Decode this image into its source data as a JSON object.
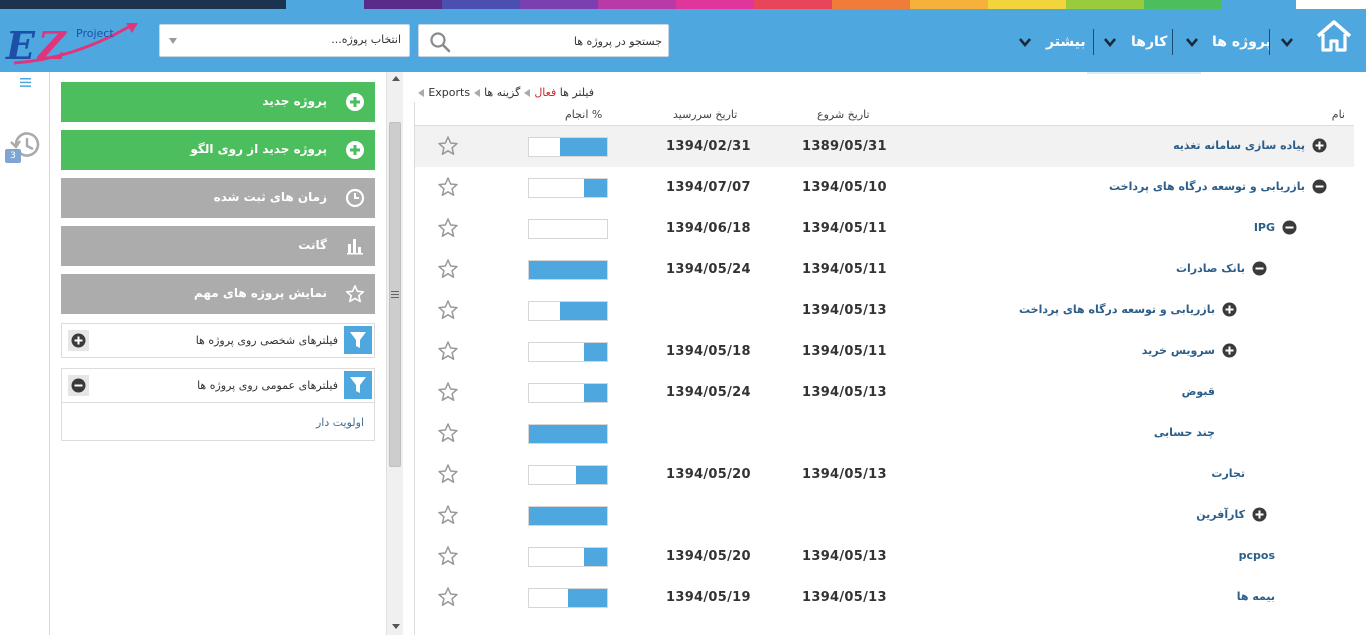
{
  "colors": {
    "header": "#4ea8df",
    "green_button": "#4dbe5e",
    "gray_button": "#acacac",
    "link": "#2c5e8a",
    "progress": "#4ea8df"
  },
  "header": {
    "logo_text": "EZ",
    "logo_sub": "Project",
    "nav": {
      "projects": "پروژه ها",
      "tasks": "کارها",
      "more": "بیشتر"
    },
    "search_placeholder": "جستجو در پروژه ها",
    "project_select": "انتخاب پروژه..."
  },
  "rail": {
    "history_count": "3"
  },
  "side": {
    "buttons": [
      {
        "label": "پروژه جدید",
        "icon": "plus-circle-icon"
      },
      {
        "label": "پروژه جدید از روی الگو",
        "icon": "plus-circle-icon"
      },
      {
        "label": "زمان های ثبت شده",
        "icon": "clock-icon"
      },
      {
        "label": "گانت",
        "icon": "gantt-chart-icon"
      },
      {
        "label": "نمایش پروژه های مهم",
        "icon": "star-icon"
      }
    ],
    "filters": {
      "personal": "فیلترهای شخصی روی پروژه ها",
      "public": "فیلترهای عمومی روی پروژه ها",
      "public_items": [
        "اولویت دار"
      ]
    }
  },
  "breadcrumb": {
    "exports": "Exports",
    "options": "گزینه ها",
    "filters": "فیلتر ها",
    "active": "فعال"
  },
  "table": {
    "headers": {
      "name": "نام",
      "start": "تاریخ شروع",
      "due": "تاریخ سررسید",
      "done": "% انجام"
    },
    "rows": [
      {
        "name": "پیاده سازی سامانه تغذیه",
        "level": 0,
        "toggle": "plus",
        "start": "1389/05/31",
        "due": "1394/02/31",
        "progress": 0.6
      },
      {
        "name": "بازریابی و توسعه درگاه های پرداخت",
        "level": 0,
        "toggle": "minus",
        "start": "1394/05/10",
        "due": "1394/07/07",
        "progress": 0.3
      },
      {
        "name": "IPG",
        "level": 1,
        "toggle": "minus",
        "start": "1394/05/11",
        "due": "1394/06/18",
        "progress": 0
      },
      {
        "name": "بانک صادرات",
        "level": 2,
        "toggle": "minus",
        "start": "1394/05/11",
        "due": "1394/05/24",
        "progress": 1
      },
      {
        "name": "بازریابی و توسعه درگاه های پرداخت",
        "level": 3,
        "toggle": "plus",
        "start": "1394/05/13",
        "due": "",
        "progress": 0.6
      },
      {
        "name": "سرویس خرید",
        "level": 3,
        "toggle": "plus",
        "start": "1394/05/11",
        "due": "1394/05/18",
        "progress": 0.3
      },
      {
        "name": "قبوض",
        "level": 3,
        "toggle": "",
        "start": "1394/05/13",
        "due": "1394/05/24",
        "progress": 0.3
      },
      {
        "name": "چند حسابی",
        "level": 3,
        "toggle": "",
        "start": "",
        "due": "",
        "progress": 1
      },
      {
        "name": "تجارت",
        "level": 2,
        "toggle": "",
        "start": "1394/05/13",
        "due": "1394/05/20",
        "progress": 0.4
      },
      {
        "name": "کارآفرین",
        "level": 2,
        "toggle": "plus",
        "start": "",
        "due": "",
        "progress": 1
      },
      {
        "name": "pcpos",
        "level": 1,
        "toggle": "",
        "start": "1394/05/13",
        "due": "1394/05/20",
        "progress": 0.3
      },
      {
        "name": "بیمه ها",
        "level": 1,
        "toggle": "",
        "start": "1394/05/13",
        "due": "1394/05/19",
        "progress": 0.5
      }
    ]
  }
}
